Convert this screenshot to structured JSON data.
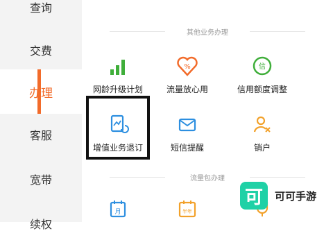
{
  "sidebar": {
    "items": [
      {
        "label": "查询"
      },
      {
        "label": "交费"
      },
      {
        "label": "办理",
        "active": true
      },
      {
        "label": "客服"
      },
      {
        "label": "宽带"
      },
      {
        "label": "续权"
      }
    ]
  },
  "sections": {
    "other": {
      "title": "其他业务办理"
    },
    "traffic": {
      "title": "流量包办理"
    }
  },
  "tiles": [
    {
      "label": "网龄升级计划",
      "icon": "signal-bars-icon",
      "color": "#3fae3a"
    },
    {
      "label": "流量放心用",
      "icon": "heart-percent-icon",
      "color": "#f26b2a"
    },
    {
      "label": "信用额度调整",
      "icon": "credit-circle-icon",
      "color": "#3fae3a"
    },
    {
      "label": "增值业务退订",
      "icon": "document-return-icon",
      "color": "#2d8fe0"
    },
    {
      "label": "短信提醒",
      "icon": "envelope-icon",
      "color": "#2d8fe0"
    },
    {
      "label": "销户",
      "icon": "user-remove-icon",
      "color": "#f2a12a"
    }
  ],
  "traffic_tiles": [
    {
      "label": "月",
      "icon": "calendar-month-icon",
      "color": "#2d8fe0"
    },
    {
      "label": "半年",
      "icon": "calendar-halfyear-icon",
      "color": "#f2a12a"
    },
    {
      "label": "",
      "icon": "trophy-icon",
      "color": "#f2a12a"
    }
  ],
  "watermark": {
    "logo_char": "可",
    "text": "可可手游"
  },
  "colors": {
    "accent": "#f26b2a",
    "sidebar_bg": "#f3f3f3"
  }
}
